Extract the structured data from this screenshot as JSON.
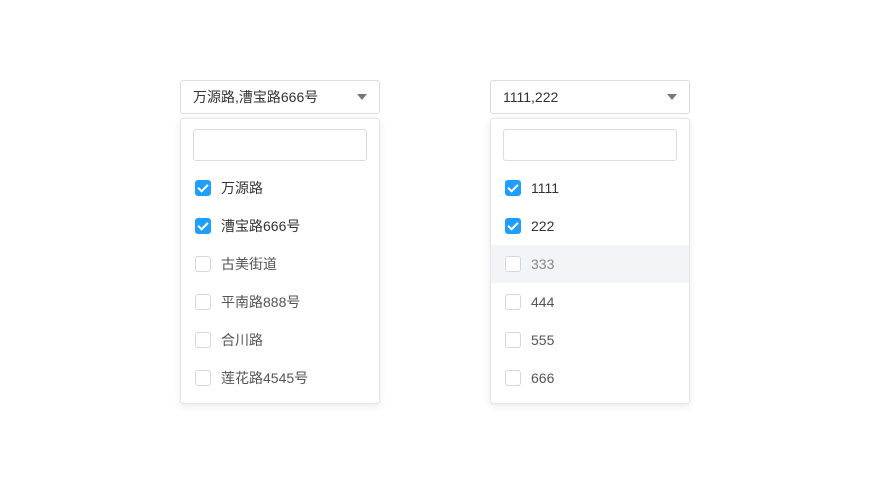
{
  "select1": {
    "selectedText": "万源路,漕宝路666号",
    "searchValue": "",
    "options": [
      {
        "label": "万源路",
        "checked": true,
        "hovered": false
      },
      {
        "label": "漕宝路666号",
        "checked": true,
        "hovered": false
      },
      {
        "label": "古美街道",
        "checked": false,
        "hovered": false
      },
      {
        "label": "平南路888号",
        "checked": false,
        "hovered": false
      },
      {
        "label": "合川路",
        "checked": false,
        "hovered": false
      },
      {
        "label": "莲花路4545号",
        "checked": false,
        "hovered": false
      }
    ]
  },
  "select2": {
    "selectedText": "1111,222",
    "searchValue": "",
    "options": [
      {
        "label": "1111",
        "checked": true,
        "hovered": false
      },
      {
        "label": "222",
        "checked": true,
        "hovered": false
      },
      {
        "label": "333",
        "checked": false,
        "hovered": true
      },
      {
        "label": "444",
        "checked": false,
        "hovered": false
      },
      {
        "label": "555",
        "checked": false,
        "hovered": false
      },
      {
        "label": "666",
        "checked": false,
        "hovered": false
      }
    ]
  }
}
